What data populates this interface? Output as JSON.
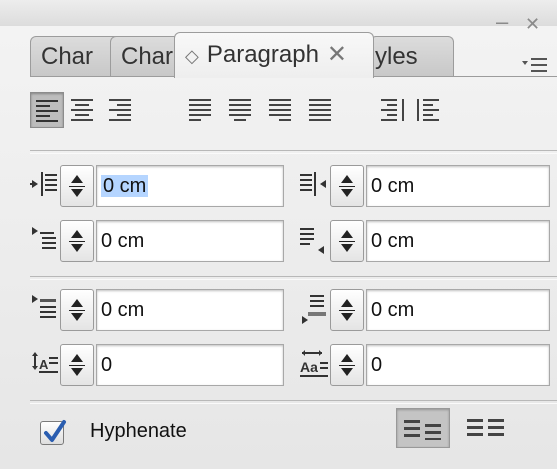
{
  "window": {
    "minimize_glyph": "–",
    "close_glyph": "✕"
  },
  "tabs": [
    {
      "label": "Char",
      "active": false
    },
    {
      "label": "Char",
      "active": false
    },
    {
      "label": "Paragraph",
      "active": true,
      "close_glyph": "✕",
      "selector_glyph": "◇"
    },
    {
      "label": "yles",
      "active": false
    }
  ],
  "panel_menu_icon": "panel-menu-icon",
  "alignment_buttons": [
    {
      "name": "align-left",
      "selected": true
    },
    {
      "name": "align-center",
      "selected": false
    },
    {
      "name": "align-right",
      "selected": false
    },
    {
      "name": "justify-last-left",
      "selected": false
    },
    {
      "name": "justify-last-center",
      "selected": false
    },
    {
      "name": "justify-last-right",
      "selected": false
    },
    {
      "name": "justify-all",
      "selected": false
    },
    {
      "name": "align-towards-spine",
      "selected": false
    },
    {
      "name": "align-away-from-spine",
      "selected": false
    }
  ],
  "fields": {
    "left_indent": {
      "value": "0 cm",
      "icon": "left-indent-icon"
    },
    "right_indent": {
      "value": "0 cm",
      "icon": "right-indent-icon"
    },
    "first_line_indent": {
      "value": "0 cm",
      "icon": "first-line-indent-icon"
    },
    "last_line_indent": {
      "value": "0 cm",
      "icon": "last-line-indent-icon"
    },
    "space_before": {
      "value": "0 cm",
      "icon": "space-before-icon"
    },
    "space_after": {
      "value": "0 cm",
      "icon": "space-after-icon"
    },
    "drop_cap_lines": {
      "value": "0",
      "icon": "drop-cap-lines-icon"
    },
    "drop_cap_chars": {
      "value": "0",
      "icon": "drop-cap-chars-icon"
    }
  },
  "hyphenate": {
    "label": "Hyphenate",
    "checked": true
  },
  "paragraph_composer_buttons": [
    {
      "name": "do-not-align-to-baseline",
      "selected": true
    },
    {
      "name": "align-to-baseline-grid",
      "selected": false
    }
  ],
  "colors": {
    "selection": "#b5d5ff",
    "checkmark": "#2a5db0"
  }
}
